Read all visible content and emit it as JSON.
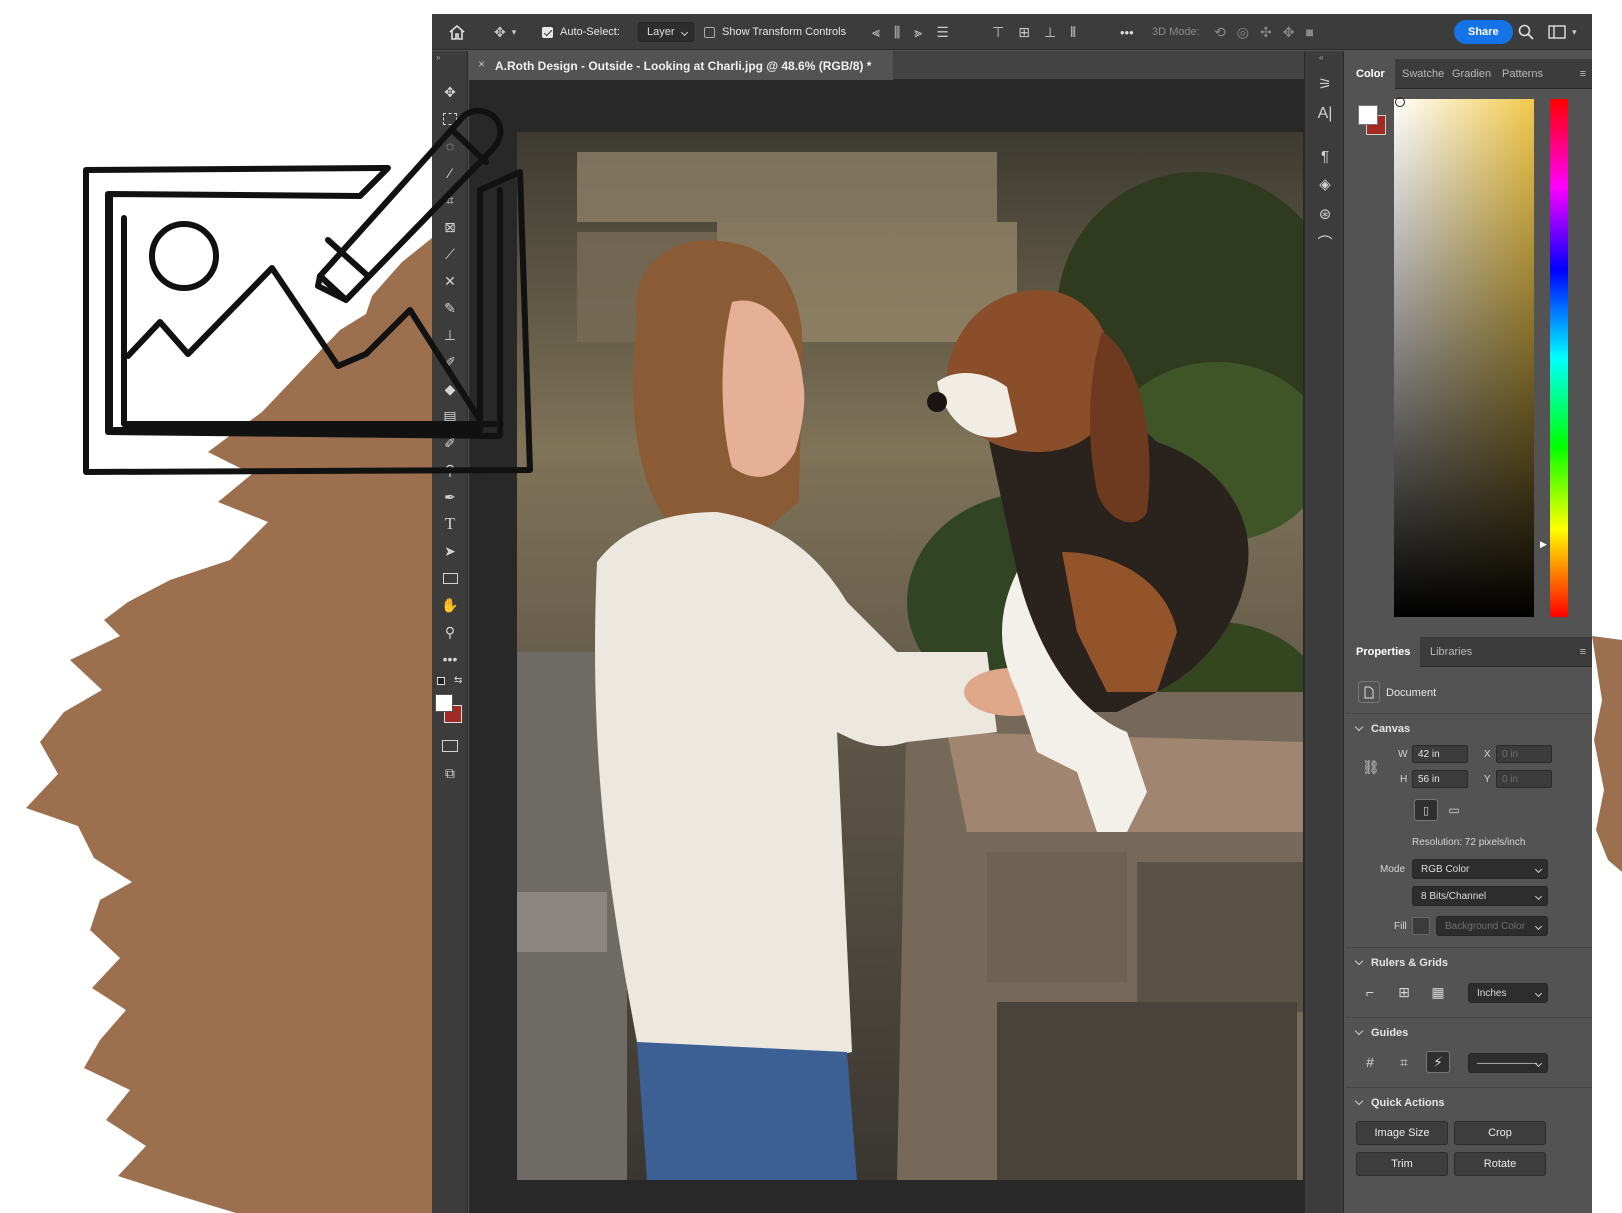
{
  "colors": {
    "brush": "#9c6f4f",
    "accent": "#1473e6",
    "foreground_swatch": "#ffffff",
    "background_swatch": "#a22a24"
  },
  "options_bar": {
    "home_icon": "home-icon",
    "move_icon": "move-tool-icon",
    "auto_select_label": "Auto-Select:",
    "auto_select_checked": true,
    "auto_select_target": "Layer",
    "show_transform_label": "Show Transform Controls",
    "show_transform_checked": false,
    "more_label": "•••",
    "mode_3d_label": "3D Mode:",
    "share_label": "Share"
  },
  "document_tab": {
    "close_glyph": "×",
    "title": "A.Roth Design - Outside - Looking at Charli.jpg @ 48.6% (RGB/8) *"
  },
  "tools": [
    "move-tool-icon",
    "marquee-tool-icon",
    "lasso-tool-icon",
    "magic-wand-icon",
    "crop-tool-icon",
    "frame-tool-icon",
    "eyedropper-icon",
    "healing-brush-icon",
    "brush-tool-icon",
    "clone-stamp-icon",
    "history-brush-icon",
    "eraser-icon",
    "gradient-tool-icon",
    "blur-tool-icon",
    "dodge-tool-icon",
    "pen-tool-icon",
    "type-tool-icon",
    "path-select-icon",
    "rectangle-tool-icon",
    "hand-tool-icon",
    "zoom-tool-icon",
    "more-tools-icon"
  ],
  "type_tool_glyph": "T",
  "more_tools_glyph": "•••",
  "color_panel": {
    "tabs": [
      "Color",
      "Swatche",
      "Gradien",
      "Patterns"
    ],
    "active_tab": "Color"
  },
  "properties_panel": {
    "tabs": [
      "Properties",
      "Libraries"
    ],
    "active_tab": "Properties",
    "document_label": "Document",
    "canvas": {
      "header": "Canvas",
      "w_label": "W",
      "w_value": "42 in",
      "h_label": "H",
      "h_value": "56 in",
      "x_label": "X",
      "x_value": "0 in",
      "y_label": "Y",
      "y_value": "0 in",
      "resolution": "Resolution: 72 pixels/inch",
      "mode_label": "Mode",
      "mode_value": "RGB Color",
      "bits_value": "8 Bits/Channel",
      "fill_label": "Fill",
      "fill_value": "Background Color"
    },
    "rulers": {
      "header": "Rulers & Grids",
      "units_value": "Inches"
    },
    "guides": {
      "header": "Guides",
      "line_style": "——————"
    },
    "quick_actions": {
      "header": "Quick Actions",
      "buttons": [
        "Image Size",
        "Crop",
        "Trim",
        "Rotate"
      ]
    }
  }
}
